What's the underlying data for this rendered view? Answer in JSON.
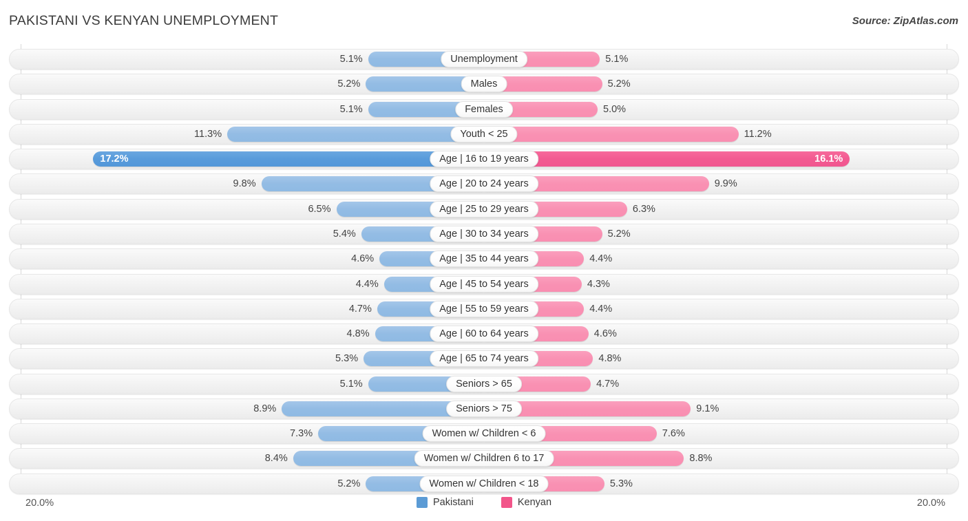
{
  "header": {
    "title": "PAKISTANI VS KENYAN UNEMPLOYMENT",
    "source": "Source: ZipAtlas.com"
  },
  "footer": {
    "axis_left": "20.0%",
    "axis_right": "20.0%",
    "legend": [
      {
        "label": "Pakistani",
        "color": "#5b9bd5"
      },
      {
        "label": "Kenyan",
        "color": "#f2558a"
      }
    ]
  },
  "colors": {
    "left_bar": "#93bce4",
    "right_bar": "#f991b3",
    "left_bar_highlight": "#589bdb",
    "right_bar_highlight": "#f25a91",
    "track": "#f2f2f2"
  },
  "chart_data": {
    "type": "bar",
    "title": "PAKISTANI VS KENYAN UNEMPLOYMENT",
    "subtitle": "Source: ZipAtlas.com",
    "orientation": "horizontal-diverging",
    "xlabel": "",
    "ylabel": "",
    "axis_max": 20.0,
    "axis_left_label": "20.0%",
    "axis_right_label": "20.0%",
    "grid": false,
    "legend_position": "bottom-center",
    "units": "%",
    "highlight_category": "Age | 16 to 19 years",
    "categories": [
      "Unemployment",
      "Males",
      "Females",
      "Youth < 25",
      "Age | 16 to 19 years",
      "Age | 20 to 24 years",
      "Age | 25 to 29 years",
      "Age | 30 to 34 years",
      "Age | 35 to 44 years",
      "Age | 45 to 54 years",
      "Age | 55 to 59 years",
      "Age | 60 to 64 years",
      "Age | 65 to 74 years",
      "Seniors > 65",
      "Seniors > 75",
      "Women w/ Children < 6",
      "Women w/ Children 6 to 17",
      "Women w/ Children < 18"
    ],
    "series": [
      {
        "name": "Pakistani",
        "color": "#5b9bd5",
        "side": "left",
        "values": [
          5.1,
          5.2,
          5.1,
          11.3,
          17.2,
          9.8,
          6.5,
          5.4,
          4.6,
          4.4,
          4.7,
          4.8,
          5.3,
          5.1,
          8.9,
          7.3,
          8.4,
          5.2
        ],
        "labels": [
          "5.1%",
          "5.2%",
          "5.1%",
          "11.3%",
          "17.2%",
          "9.8%",
          "6.5%",
          "5.4%",
          "4.6%",
          "4.4%",
          "4.7%",
          "4.8%",
          "5.3%",
          "5.1%",
          "8.9%",
          "7.3%",
          "8.4%",
          "5.2%"
        ]
      },
      {
        "name": "Kenyan",
        "color": "#f2558a",
        "side": "right",
        "values": [
          5.1,
          5.2,
          5.0,
          11.2,
          16.1,
          9.9,
          6.3,
          5.2,
          4.4,
          4.3,
          4.4,
          4.6,
          4.8,
          4.7,
          9.1,
          7.6,
          8.8,
          5.3
        ],
        "labels": [
          "5.1%",
          "5.2%",
          "5.0%",
          "11.2%",
          "16.1%",
          "9.9%",
          "6.3%",
          "5.2%",
          "4.4%",
          "4.3%",
          "4.4%",
          "4.6%",
          "4.8%",
          "4.7%",
          "9.1%",
          "7.6%",
          "8.8%",
          "5.3%"
        ]
      }
    ]
  }
}
